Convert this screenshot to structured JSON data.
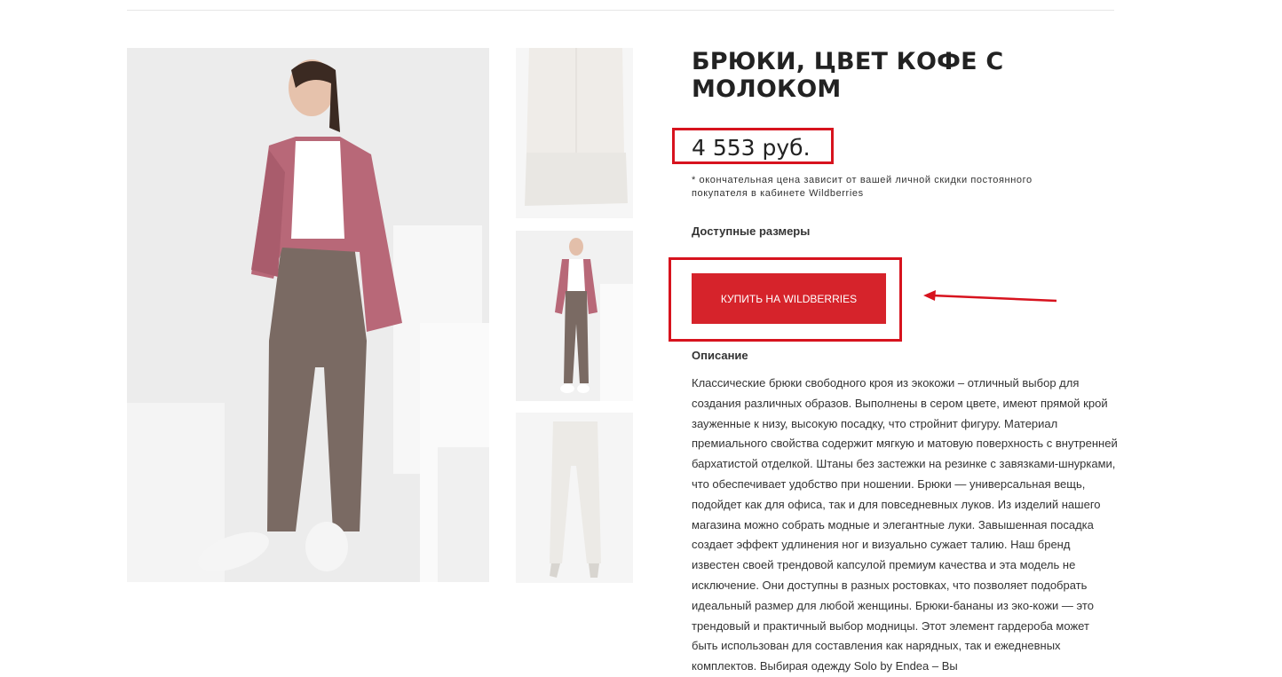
{
  "product": {
    "title": "БРЮКИ, ЦВЕТ КОФЕ С МОЛОКОМ",
    "price": "4 553 руб.",
    "price_note": "* окончательная цена зависит от вашей личной скидки постоянного покупателя в кабинете Wildberries",
    "sizes_label": "Доступные размеры",
    "buy_label": "КУПИТЬ НА WILDBERRIES",
    "description_label": "Описание",
    "description": "Классические брюки свободного кроя из экокожи – отличный выбор для создания различных образов. Выполнены в сером цвете, имеют прямой крой зауженные к низу, высокую посадку, что стройнит фигуру. Материал премиального свойства содержит мягкую и матовую поверхность с внутренней бархатистой отделкой. Штаны без застежки на резинке с завязками-шнурками, что обеспечивает удобство при ношении. Брюки — универсальная вещь, подойдет как для офиса, так и для повседневных луков. Из изделий нашего магазина можно собрать модные и элегантные луки. Завышенная посадка создает эффект удлинения ног и визуально сужает талию. Наш бренд известен своей трендовой капсулой премиум качества и эта модель не исключение. Они доступны в разных ростовках, что позволяет подобрать идеальный размер для любой женщины. Брюки-бананы из эко-кожи — это трендовый и практичный выбор модницы. Этот элемент гардероба может быть использован для составления как нарядных, так и ежедневных комплектов. Выбирая одежду Solo by Endea – Вы"
  },
  "gallery": {
    "main_image": "woman-in-pink-blazer-and-brown-pants-photo",
    "thumbnails": [
      "pants-cuff-closeup-photo",
      "woman-full-outfit-photo",
      "light-pants-on-mannequin-photo"
    ]
  },
  "colors": {
    "accent": "#d6232b",
    "highlight_box": "#d7131e",
    "blazer": "#b86878",
    "pants": "#7a6a63"
  }
}
